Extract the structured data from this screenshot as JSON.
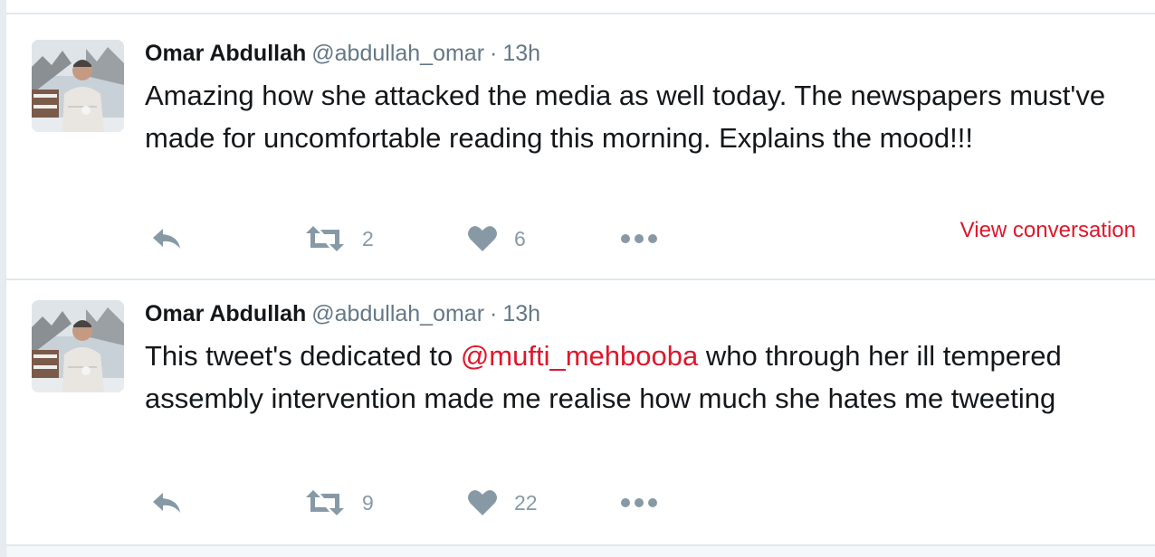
{
  "tweets": [
    {
      "author_name": "Omar Abdullah",
      "handle": "@abdullah_omar",
      "separator": "·",
      "time": "13h",
      "text": "Amazing how she attacked the media as well today. The newspapers must've made for uncomfortable reading this morning. Explains the mood!!!",
      "retweets": "2",
      "likes": "6",
      "view_conversation": "View conversation"
    },
    {
      "author_name": "Omar Abdullah",
      "handle": "@abdullah_omar",
      "separator": "·",
      "time": "13h",
      "text_before": "This tweet's dedicated to ",
      "mention": "@mufti_mehbooba",
      "text_after": " who through her ill tempered assembly intervention made me realise how much she hates me tweeting",
      "retweets": "9",
      "likes": "22"
    }
  ],
  "icons": {
    "reply": "reply-icon",
    "retweet": "retweet-icon",
    "like": "heart-icon",
    "more": "more-dots-icon"
  },
  "colors": {
    "text": "#14171a",
    "secondary": "#657786",
    "icon": "#8899a6",
    "mention": "#e0162b",
    "divider": "#e1e8ed"
  }
}
